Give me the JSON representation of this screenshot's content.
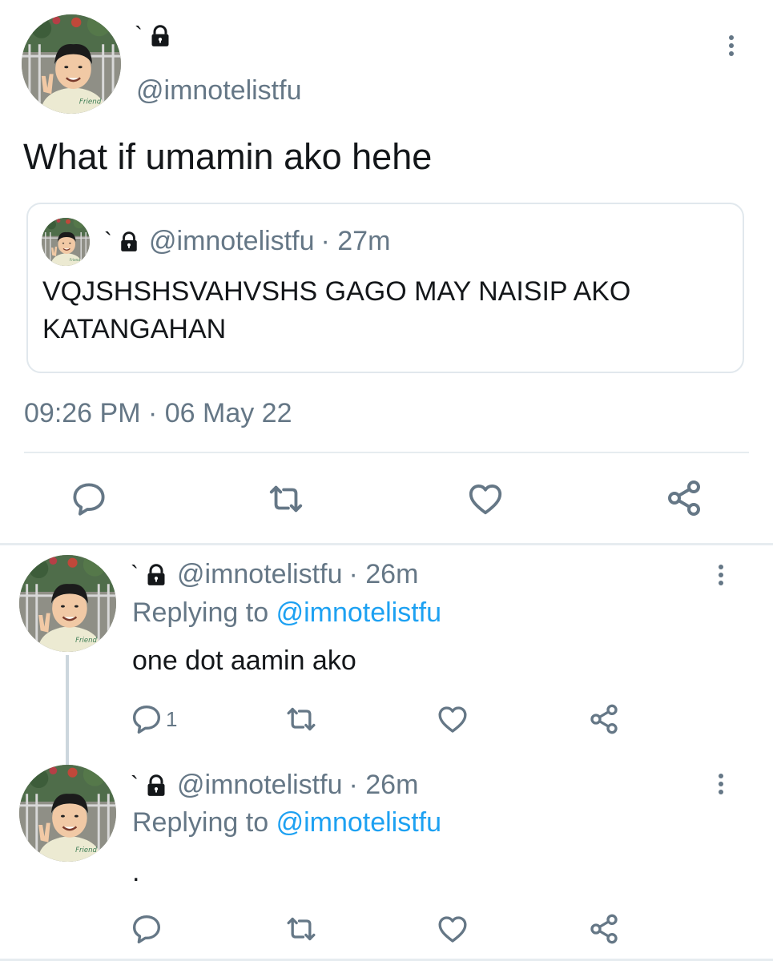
{
  "main_tweet": {
    "display_name": "`",
    "handle": "@imnotelistfu",
    "text": "What if umamin ako hehe",
    "timestamp": "09:26 PM · 06 May 22",
    "quoted": {
      "display_name": "`",
      "handle": "@imnotelistfu",
      "time": "· 27m",
      "text_line1": "VQJSHSHSVAHVSHS GAGO MAY NAISIP AKO",
      "text_line2": "KATANGAHAN"
    }
  },
  "replies": [
    {
      "display_name": "`",
      "handle": "@imnotelistfu",
      "time": "· 26m",
      "replying_prefix": "Replying to",
      "replying_to": "@imnotelistfu",
      "text": "one dot aamin ako",
      "reply_count": "1"
    },
    {
      "display_name": "`",
      "handle": "@imnotelistfu",
      "time": "· 26m",
      "replying_prefix": "Replying to",
      "replying_to": "@imnotelistfu",
      "text": ".",
      "reply_count": ""
    }
  ],
  "icons": {
    "lock": "lock-icon",
    "more": "more-vertical-icon",
    "reply": "reply-bubble-icon",
    "retweet": "retweet-icon",
    "like": "heart-icon",
    "share": "share-icon"
  },
  "colors": {
    "text": "#14171a",
    "secondary": "#657786",
    "link": "#1da1f2",
    "divider": "#e6ecf0"
  }
}
